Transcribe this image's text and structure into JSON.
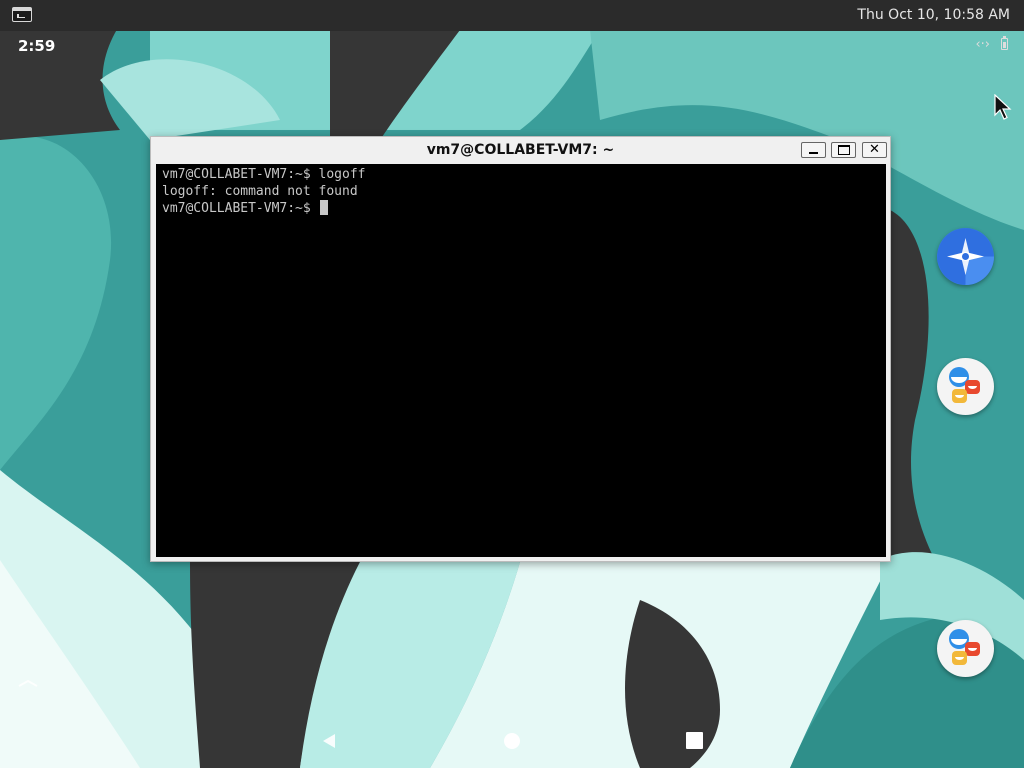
{
  "top_panel": {
    "app_icon": "terminal-icon",
    "clock": "Thu Oct 10, 10:58 AM"
  },
  "status_bar": {
    "time": "2:59",
    "icons": [
      "link-icon",
      "battery-icon"
    ]
  },
  "terminal": {
    "title": "vm7@COLLABET-VM7: ~",
    "lines": [
      "vm7@COLLABET-VM7:~$ logoff",
      "logoff: command not found",
      "vm7@COLLABET-VM7:~$ "
    ],
    "buttons": [
      "minimize-icon",
      "maximize-icon",
      "close-icon"
    ],
    "close_glyph": "✕"
  },
  "shortcuts": [
    "compass-icon",
    "chat-icon",
    "chat-icon"
  ],
  "nav_bar": [
    "back-icon",
    "home-icon",
    "recents-icon"
  ],
  "colors": {
    "wallpaper_base": "#3a9e9a",
    "wallpaper_light": "#b8ece6",
    "wallpaper_dark": "#363636",
    "terminal_bg": "#000000",
    "terminal_fg": "#c8c8c8"
  }
}
